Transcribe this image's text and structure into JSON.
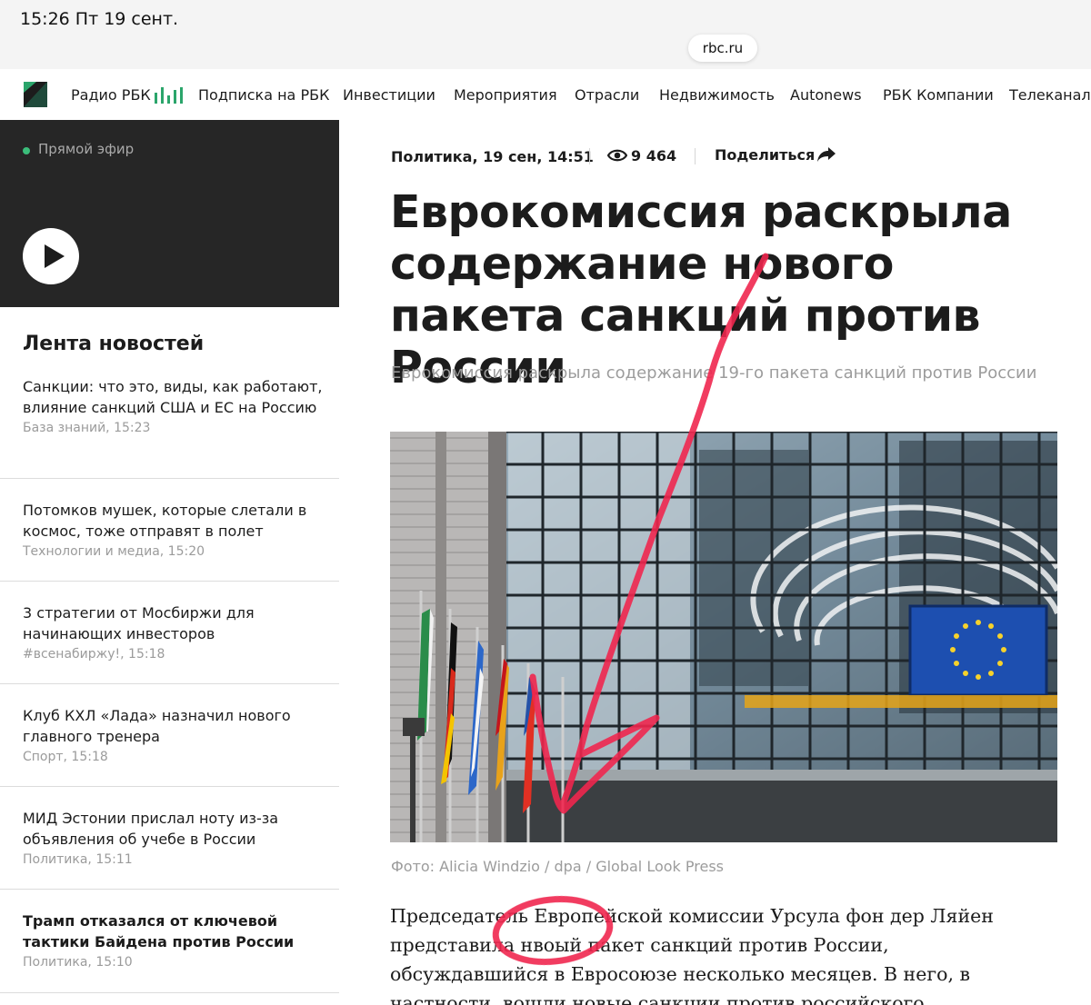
{
  "status_bar": {
    "time_date": "15:26   Пт 19 сент.",
    "url": "rbc.ru"
  },
  "nav": {
    "items": [
      "Радио РБК",
      "Подписка на РБК",
      "Инвестиции",
      "Мероприятия",
      "Отрасли",
      "Недвижимость",
      "Autonews",
      "РБК Компании",
      "Телеканал"
    ],
    "accent": "#2ba56b"
  },
  "live": {
    "label": "Прямой эфир"
  },
  "feed": {
    "title": "Лента новостей",
    "items": [
      {
        "title": "Санкции: что это, виды, как работают, влияние санкций США и ЕС на Россию",
        "meta": "База знаний, 15:23"
      },
      {
        "title": "Потомков мушек, которые слетали в космос, тоже отправят в полет",
        "meta": "Технологии и медиа, 15:20"
      },
      {
        "title": "3 стратегии от Мосбиржи для начинающих инвесторов",
        "meta": "#всенабиржу!, 15:18"
      },
      {
        "title": "Клуб КХЛ «Лада» назначил нового главного тренера",
        "meta": "Спорт, 15:18"
      },
      {
        "title": "МИД Эстонии прислал ноту из-за объявления об учебе в России",
        "meta": "Политика, 15:11"
      },
      {
        "title": "Трамп отказался от ключевой тактики Байдена против России",
        "meta": "Политика, 15:10"
      }
    ]
  },
  "article": {
    "meta": {
      "date": "Политика, 19 сен, 14:51",
      "views": "9 464",
      "share": "Поделиться"
    },
    "headline": "Еврокомиссия раскрыла содержание нового пакета санкций против России",
    "subtitle": "Еврокомиссия раскрыла содержание 19-го пакета санкций против России",
    "photo_caption": "Фото: Alicia Windzio / dpa / Global Look Press",
    "body": "Председатель Европейской комиссии Урсула фон дер Ляйен представила нвоый пакет санкций против России, обсуждавшийся в Евросоюзе несколько месяцев. В него, в частности, вошли новые санкции против российского"
  },
  "annotation_color": "#f0264f"
}
